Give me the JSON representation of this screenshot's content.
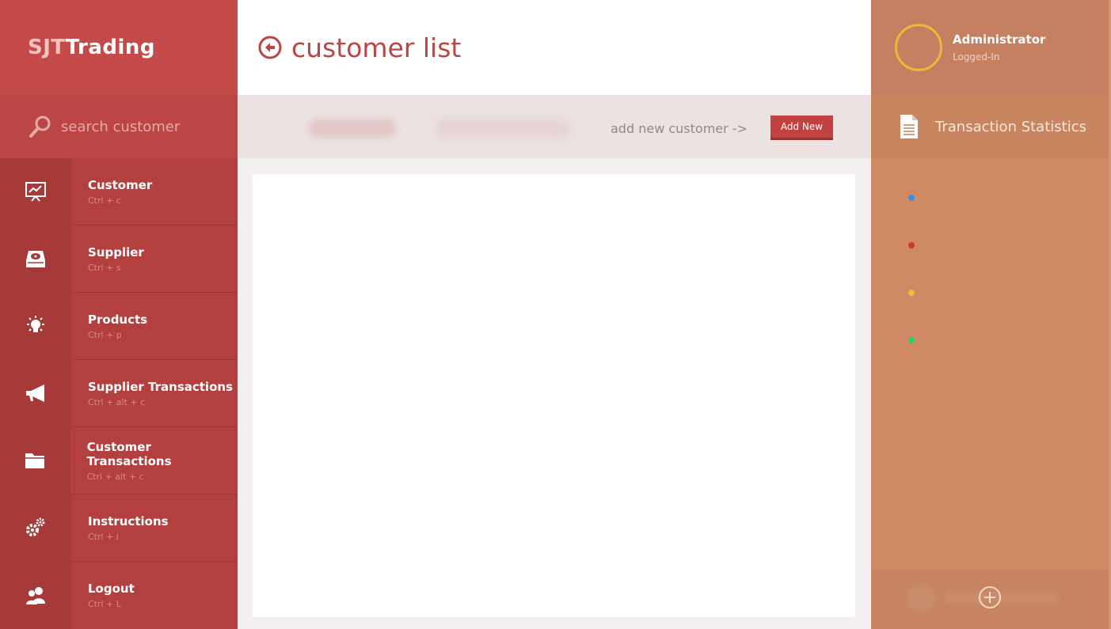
{
  "brand": {
    "part1": "SJT",
    "part2": "Trading"
  },
  "search": {
    "placeholder": "search customer"
  },
  "nav": [
    {
      "label": "Customer",
      "shortcut": "Ctrl + c",
      "icon": "presentation-chart-icon"
    },
    {
      "label": "Supplier",
      "shortcut": "Ctrl + s",
      "icon": "hard-drive-icon"
    },
    {
      "label": "Products",
      "shortcut": "Ctrl + p",
      "icon": "lightbulb-icon"
    },
    {
      "label": "Supplier Transactions",
      "shortcut": "Ctrl + alt + c",
      "icon": "megaphone-icon"
    },
    {
      "label": "Customer Transactions",
      "shortcut": "Ctrl + alt + c",
      "icon": "folder-icon"
    },
    {
      "label": "Instructions",
      "shortcut": "Ctrl + i",
      "icon": "gears-icon"
    },
    {
      "label": "Logout",
      "shortcut": "Ctrl + L",
      "icon": "users-icon"
    }
  ],
  "page": {
    "title": "customer list"
  },
  "toolbar": {
    "add_hint": "add new customer ->",
    "add_button": "Add New"
  },
  "user": {
    "name": "Administrator",
    "status": "Logged-In"
  },
  "stats": {
    "title": "Transaction Statistics",
    "dots": [
      "#3b8fdc",
      "#c83a2c",
      "#f2c02c",
      "#2ecc71"
    ]
  }
}
